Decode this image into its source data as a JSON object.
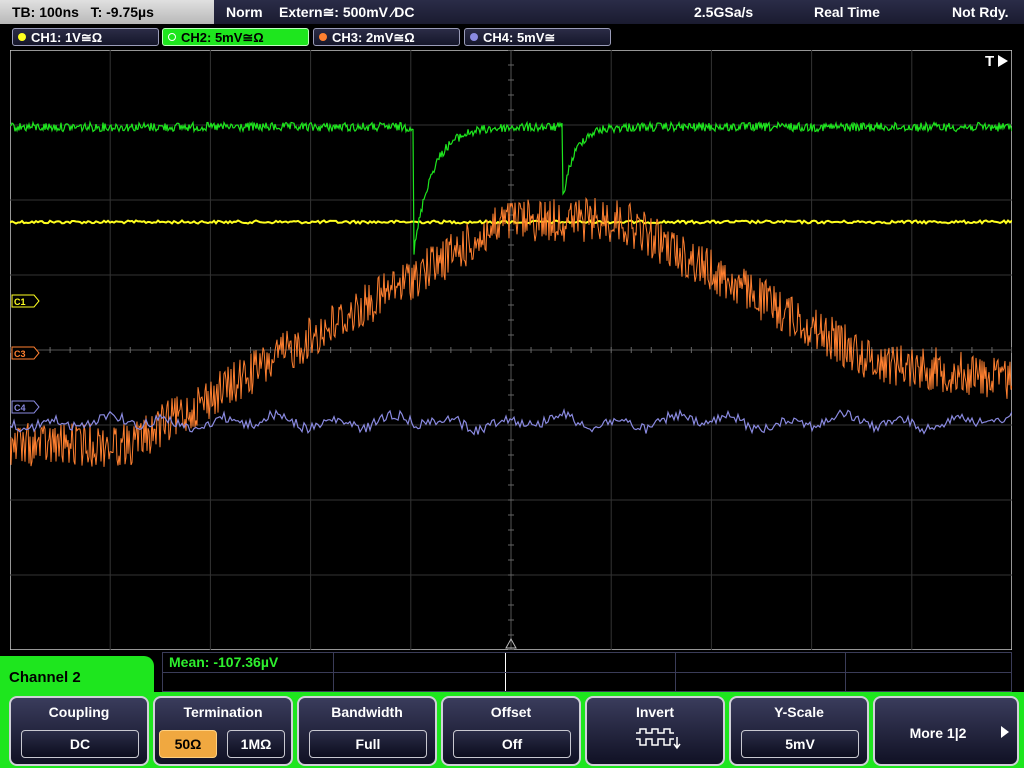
{
  "status": {
    "timebase": "TB: 100ns",
    "trigger_time": "T: -9.75µs",
    "trigger_mode": "Norm",
    "trigger_source": "Extern≅: 500mV ⁄DC",
    "sample_rate": "2.5GSa/s",
    "acq_mode": "Real Time",
    "acq_state": "Not Rdy."
  },
  "channels": [
    {
      "label": "CH1: 1V≅Ω",
      "color": "#ffff20"
    },
    {
      "label": "CH2: 5mV≅Ω",
      "color": "#1ee61e"
    },
    {
      "label": "CH3: 2mV≅Ω",
      "color": "#ff8030"
    },
    {
      "label": "CH4: 5mV≅",
      "color": "#8a8ae0"
    }
  ],
  "markers": {
    "c1": "C1",
    "c3": "C3",
    "c4": "C4",
    "trigger": "T"
  },
  "measurement": {
    "mean": "Mean: -107.36µV"
  },
  "panel": {
    "channel_label": "Channel 2"
  },
  "softkeys": {
    "coupling": {
      "title": "Coupling",
      "value": "DC"
    },
    "termination": {
      "title": "Termination",
      "opt1": "50Ω",
      "opt2": "1MΩ"
    },
    "bandwidth": {
      "title": "Bandwidth",
      "value": "Full"
    },
    "offset": {
      "title": "Offset",
      "value": "Off"
    },
    "invert": {
      "title": "Invert"
    },
    "yscale": {
      "title": "Y-Scale",
      "value": "5mV"
    },
    "more": {
      "label": "More 1|2"
    }
  }
}
